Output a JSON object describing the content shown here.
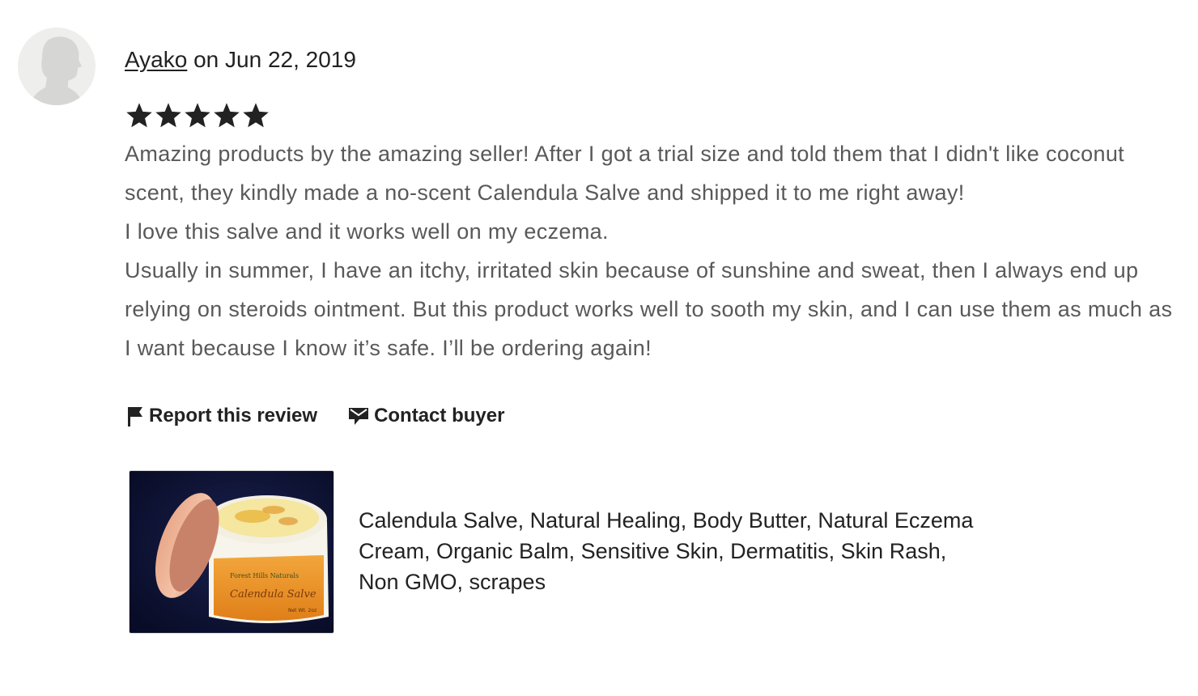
{
  "review": {
    "reviewer_name": "Ayako",
    "date_text": "on Jun 22, 2019",
    "rating": 5,
    "rating_max": 5,
    "paragraphs": [
      "Amazing products by the amazing seller! After I got a trial size and told them that I didn't like coconut scent, they kindly made a no-scent Calendula Salve and shipped it to me right away!",
      "I love this salve and it works well on my eczema.",
      "Usually in summer, I have an itchy, irritated skin because of sunshine and sweat, then I always end up relying on steroids ointment. But this product works well to sooth my skin, and I can use them as much as I want because I know it’s safe. I’ll be ordering again!"
    ]
  },
  "actions": {
    "report_label": "Report this review",
    "contact_label": "Contact buyer"
  },
  "product": {
    "title": "Calendula Salve, Natural Healing, Body Butter, Natural Eczema Cream, Organic Balm, Sensitive Skin, Dermatitis, Skin Rash, Non GMO, scrapes",
    "jar_label_top": "Forest Hills Naturals",
    "jar_label_main": "Calendula Salve",
    "jar_label_bottom": "Net Wt. 2oz"
  },
  "icons": {
    "avatar": "default-user-silhouette-icon",
    "star": "star-icon",
    "report": "flag-icon",
    "contact": "message-icon"
  },
  "colors": {
    "text_primary": "#222222",
    "text_body": "#595959",
    "avatar_bg": "#eeeeec",
    "star": "#222222"
  }
}
